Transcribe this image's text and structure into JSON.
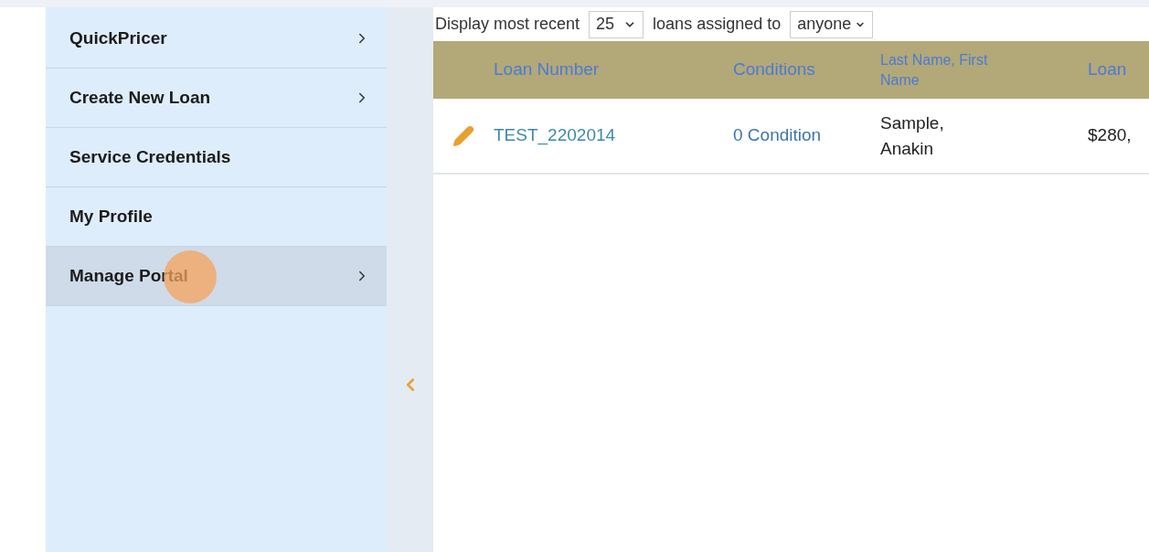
{
  "sidebar": {
    "items": [
      {
        "label": "QuickPricer",
        "has_submenu": true,
        "selected": false
      },
      {
        "label": "Create New Loan",
        "has_submenu": true,
        "selected": false
      },
      {
        "label": "Service Credentials",
        "has_submenu": false,
        "selected": false
      },
      {
        "label": "My Profile",
        "has_submenu": false,
        "selected": false
      },
      {
        "label": "Manage Portal",
        "has_submenu": true,
        "selected": true
      }
    ]
  },
  "filter": {
    "prefix": "Display most recent",
    "count": "25",
    "middle": "loans assigned to",
    "assignee": "anyone"
  },
  "table": {
    "columns": [
      "Loan Number",
      "Conditions",
      "Last Name, First Name",
      "Loan"
    ],
    "rows": [
      {
        "loan_number": "TEST_2202014",
        "conditions": "0 Condition",
        "name": "Sample, Anakin",
        "amount": "$280,"
      }
    ]
  }
}
